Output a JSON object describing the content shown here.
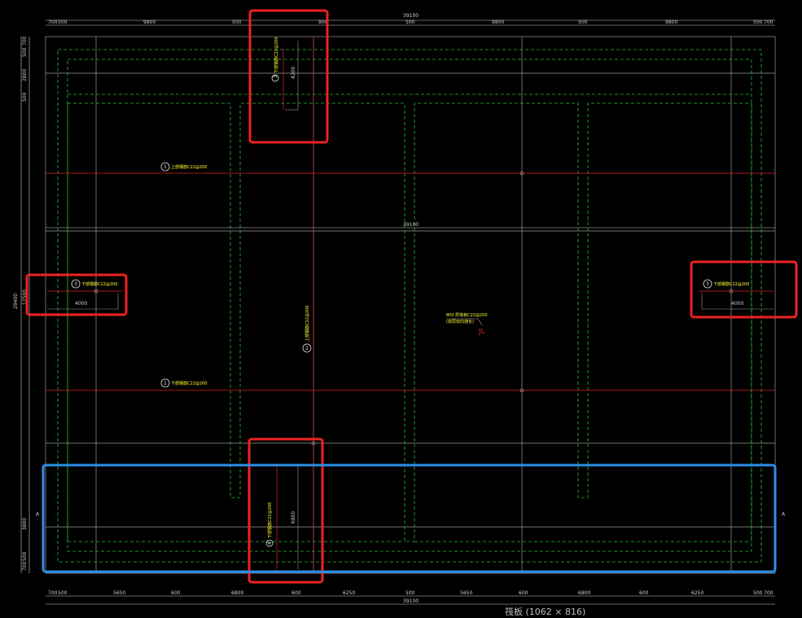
{
  "caption": "筏板 (1062 × 816)",
  "dims": {
    "top_total": "39100",
    "top_segments": [
      "700",
      "500",
      "9800",
      "500",
      "900",
      "500",
      "9800",
      "500",
      "9800",
      "500",
      "700"
    ],
    "bottom_total": "39100",
    "bottom_segments": [
      "700",
      "500",
      "5650",
      "600",
      "6800",
      "600",
      "6250",
      "500",
      "5650",
      "600",
      "6800",
      "600",
      "6250",
      "500",
      "700"
    ],
    "mid_total": "39100",
    "left_total": "29400",
    "left_segments": [
      "700",
      "500",
      "2800",
      "500",
      "3800",
      "500",
      "700"
    ],
    "left_mid": "12500"
  },
  "labels": {
    "top_vertical": "下部钢筋C22@200",
    "top_mark": "3",
    "top_len": "4200",
    "row1": "上部钢筋C22@200",
    "row1_mark": "1",
    "left_bar": "下部钢筋C22@200",
    "left_mark": "3",
    "left_len": "4000",
    "right_bar": "下部钢筋C22@200",
    "right_mark": "3",
    "right_len": "4000",
    "center_vertical": "上部钢筋C22@200",
    "center_mark": "2",
    "note_line1": "800 厚筏板C22@200",
    "note_line2": "(双层双向通长)",
    "jl": "JL",
    "row2": "下部钢筋C22@200",
    "row2_mark": "1",
    "bottom_vertical": "下部钢筋C22@200",
    "bottom_mark": "4",
    "bottom_len": "6800",
    "axis_a_left": "A",
    "axis_a_right": "A"
  },
  "colors": {
    "background": "#000000",
    "grid": "#9a9a9a",
    "dashed": "#22c43a",
    "rebar": "#e02020",
    "text": "#ffff33",
    "highlight_red": "#ee2222",
    "highlight_blue": "#2a8fe8"
  }
}
